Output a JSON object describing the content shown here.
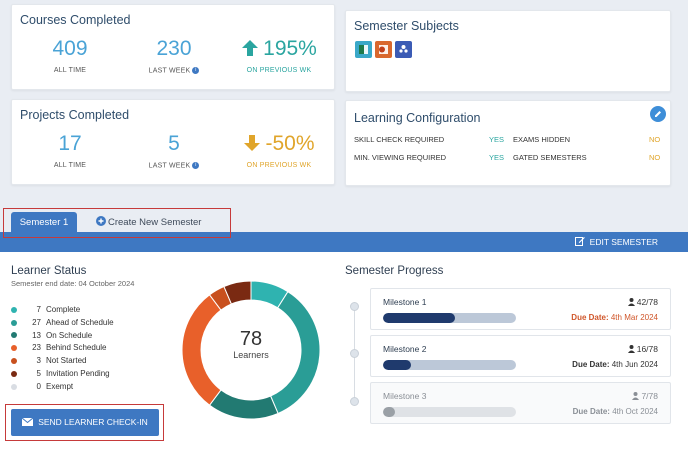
{
  "courses": {
    "title": "Courses Completed",
    "all_time": {
      "value": "409",
      "label": "ALL TIME"
    },
    "last_week": {
      "value": "230",
      "label": "LAST WEEK"
    },
    "previous": {
      "value": "195%",
      "label": "ON PREVIOUS WK"
    }
  },
  "projects": {
    "title": "Projects Completed",
    "all_time": {
      "value": "17",
      "label": "ALL TIME"
    },
    "last_week": {
      "value": "5",
      "label": "LAST WEEK"
    },
    "previous": {
      "value": "-50%",
      "label": "ON PREVIOUS WK"
    }
  },
  "subjects": {
    "title": "Semester Subjects",
    "icons": [
      "excel-icon",
      "powerpoint-icon",
      "teams-icon"
    ]
  },
  "config": {
    "title": "Learning Configuration",
    "rows": [
      {
        "left_label": "SKILL CHECK REQUIRED",
        "left_value": "YES",
        "right_label": "EXAMS HIDDEN",
        "right_value": "NO"
      },
      {
        "left_label": "MIN. VIEWING REQUIRED",
        "left_value": "YES",
        "right_label": "GATED SEMESTERS",
        "right_value": "NO"
      }
    ]
  },
  "tabs": {
    "active": "Semester 1",
    "create": "Create New Semester",
    "edit": "EDIT SEMESTER"
  },
  "learner_status": {
    "title": "Learner Status",
    "end_date": "Semester end date: 04 October 2024",
    "total": "78",
    "total_label": "Learners",
    "items": [
      {
        "count": "7",
        "label": "Complete",
        "color": "#2fb3b0",
        "value": 7
      },
      {
        "count": "27",
        "label": "Ahead of Schedule",
        "color": "#2a9d96",
        "value": 27
      },
      {
        "count": "13",
        "label": "On Schedule",
        "color": "#227a72",
        "value": 13
      },
      {
        "count": "23",
        "label": "Behind Schedule",
        "color": "#e8602a",
        "value": 23
      },
      {
        "count": "3",
        "label": "Not Started",
        "color": "#c8501e",
        "value": 3
      },
      {
        "count": "5",
        "label": "Invitation Pending",
        "color": "#7a2a12",
        "value": 5
      },
      {
        "count": "0",
        "label": "Exempt",
        "color": "#d9dde3",
        "value": 0
      }
    ],
    "button": "SEND LEARNER CHECK-IN"
  },
  "progress": {
    "title": "Semester Progress",
    "milestones": [
      {
        "title": "Milestone 1",
        "count": "42/78",
        "progress": 0.54,
        "due_label": "Due Date:",
        "due": "4th Mar 2024",
        "due_color": "#d0562a"
      },
      {
        "title": "Milestone 2",
        "count": "16/78",
        "progress": 0.21,
        "due_label": "Due Date:",
        "due": "4th Jun 2024",
        "due_color": "#333333"
      },
      {
        "title": "Milestone 3",
        "count": "7/78",
        "progress": 0.09,
        "due_label": "Due Date:",
        "due": "4th Oct 2024",
        "due_color": "#8a8f96"
      }
    ]
  }
}
